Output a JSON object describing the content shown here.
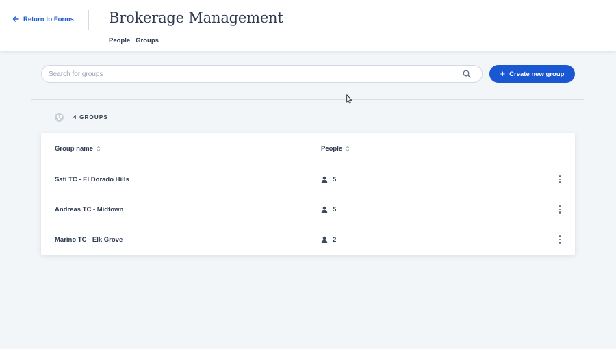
{
  "header": {
    "back_label": "Return to Forms",
    "title": "Brokerage Management",
    "tabs": [
      {
        "label": "People",
        "active": false
      },
      {
        "label": "Groups",
        "active": true
      }
    ]
  },
  "toolbar": {
    "search_placeholder": "Search for groups",
    "search_value": "",
    "create_label": "Create new group"
  },
  "summary": {
    "count_label": "4 GROUPS"
  },
  "table": {
    "columns": [
      {
        "label": "Group name",
        "sortable": true
      },
      {
        "label": "People",
        "sortable": true
      }
    ],
    "rows": [
      {
        "name": "Sati TC - El Dorado Hills",
        "people": "5"
      },
      {
        "name": "Andreas TC - Midtown",
        "people": "5"
      },
      {
        "name": "Marino TC - Elk Grove",
        "people": "2"
      }
    ]
  },
  "colors": {
    "accent": "#1958d2",
    "text": "#2e3b52",
    "background": "#f3f6f9"
  },
  "icons": {
    "back": "arrow-left-icon",
    "search": "search-icon",
    "create": "plus-icon",
    "count": "groups-icon",
    "sort": "sort-icon",
    "person": "person-icon",
    "menu": "kebab-menu-icon"
  }
}
